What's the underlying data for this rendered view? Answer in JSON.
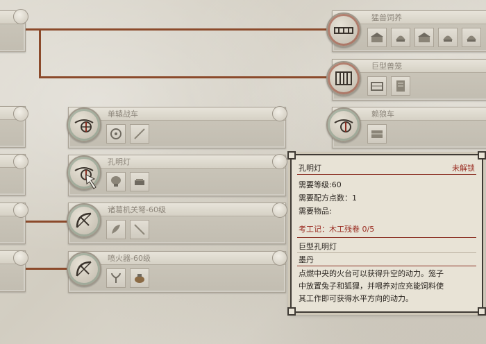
{
  "nodes": {
    "beast_raising": {
      "title": "猛兽饲养"
    },
    "giant_cage": {
      "title": "巨型兽笼"
    },
    "single_chariot": {
      "title": "单辕战车"
    },
    "wolf_cart": {
      "title": "赖狼车"
    },
    "kongming_lantern": {
      "title": "孔明灯"
    },
    "zhuge_crossbow": {
      "title": "诸葛机关弩-60级"
    },
    "fire_thrower": {
      "title": "喷火器-60级"
    }
  },
  "tooltip": {
    "name": "孔明灯",
    "status": "未解锁",
    "level_req": "需要等级:60",
    "points_req": "需要配方点数：1",
    "items_req": "需要物品:",
    "book_req": "考工记：木工残卷 0/5",
    "unlock_1": "巨型孔明灯",
    "unlock_2": "墨丹",
    "description_1": "点燃中央的火台可以获得升空的动力。笼子",
    "description_2": "中放置兔子和狐狸，并喂养对应充能饲料使",
    "description_3": "其工作即可获得水平方向的动力。"
  },
  "colors": {
    "connector": "#8b4a2b",
    "status_red": "#9a2c21"
  }
}
